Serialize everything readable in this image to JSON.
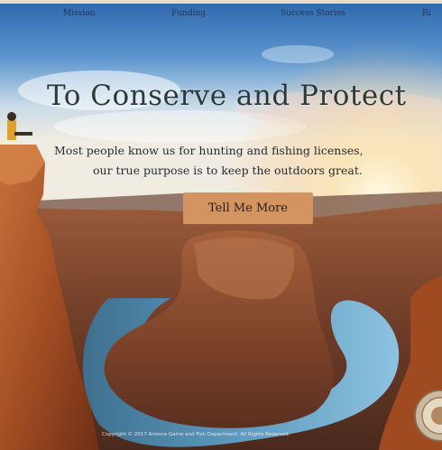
{
  "nav": {
    "items": [
      {
        "label": "Mission"
      },
      {
        "label": "Funding"
      },
      {
        "label": "Success Stories"
      },
      {
        "label": "Ri"
      }
    ]
  },
  "hero": {
    "title": "To Conserve and Protect",
    "subtitle_line1": "Most people know us for hunting and fishing licenses,",
    "subtitle_line2": "our true purpose is to keep the outdoors great.",
    "cta_label": "Tell Me More"
  },
  "footer": {
    "copyright": "Copyright © 2017 Arizona Game and Fish Department. All Rights Reserved."
  },
  "colors": {
    "sky_top": "#2f6fb8",
    "sky_horizon": "#e9eef2",
    "rock": "#b5582a",
    "river": "#4f8fb8",
    "cta": "#d49461",
    "title_text": "#2a3a3a"
  },
  "icons": {
    "seal": "agency-seal-icon"
  }
}
